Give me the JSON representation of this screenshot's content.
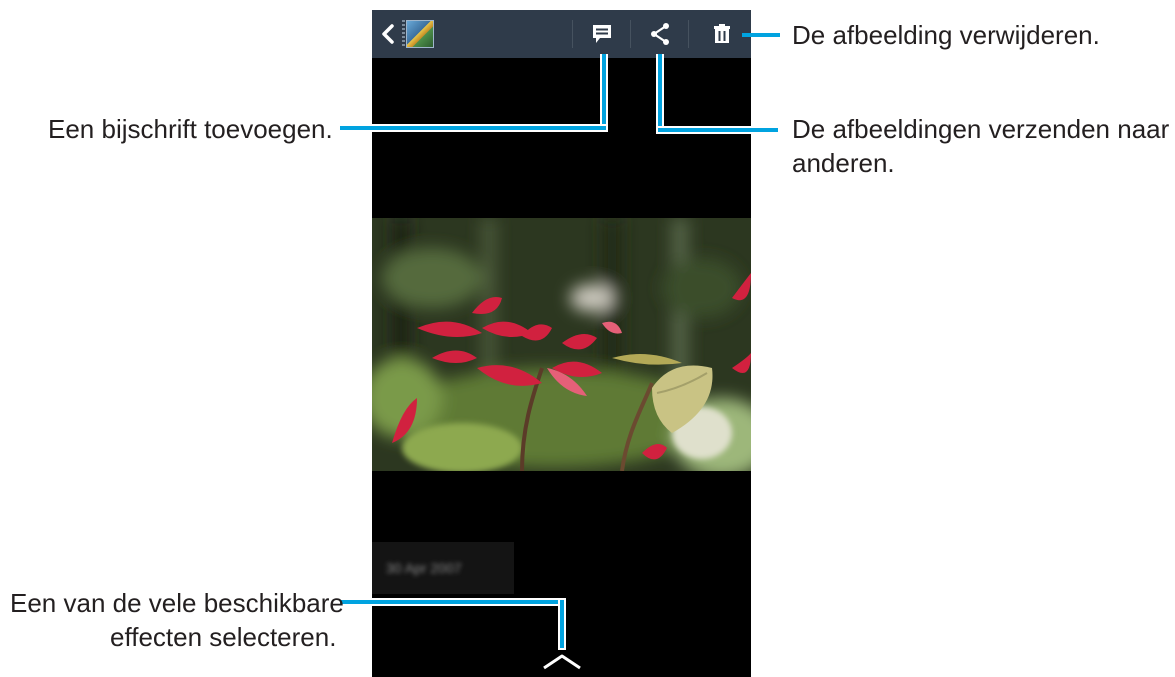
{
  "callouts": {
    "delete": "De afbeelding verwijderen.",
    "caption": "Een bijschrift toevoegen.",
    "share_line1": "De afbeeldingen verzenden naar",
    "share_line2": "anderen.",
    "effects_line1": "Een van de vele beschikbare",
    "effects_line2": "effecten selecteren."
  },
  "phone": {
    "icons": {
      "back": "chevron-left-icon",
      "thumbnail": "album-thumbnail",
      "caption": "caption-icon",
      "share": "share-icon",
      "delete": "trash-icon",
      "effects": "chevron-up-icon"
    },
    "date_chip_text": "30 Apr 2007"
  },
  "colors": {
    "callout_line": "#00a3e0",
    "topbar": "#2f3b4a",
    "screen_bg": "#000000",
    "label_text": "#231f20"
  }
}
